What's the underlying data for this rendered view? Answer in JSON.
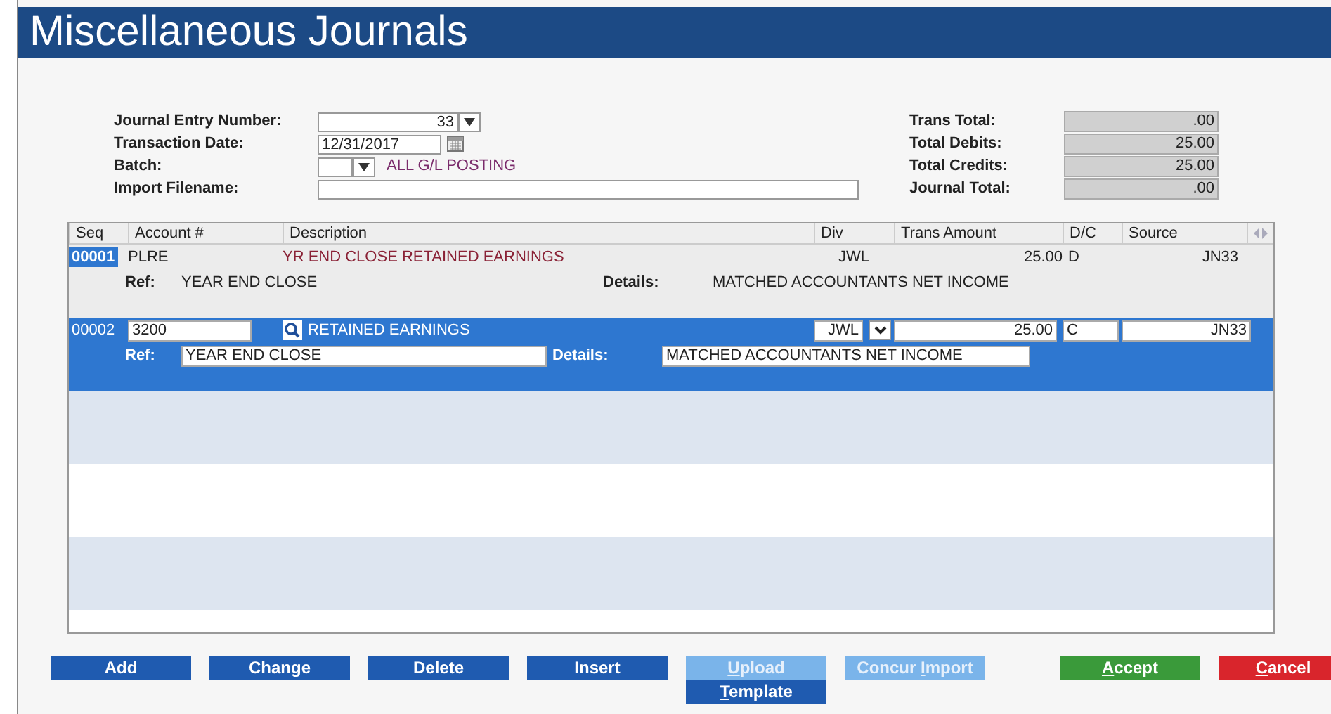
{
  "window": {
    "title": "Miscellaneous Journals"
  },
  "form": {
    "fields": [
      {
        "label": "Journal Entry Number:",
        "kind": "dropdown",
        "value": "33"
      },
      {
        "label": "Transaction Date:",
        "kind": "date",
        "value": "12/31/2017"
      },
      {
        "label": "Batch:",
        "kind": "batch",
        "note": "ALL G/L POSTING"
      },
      {
        "label": "Import Filename:",
        "kind": "text"
      }
    ],
    "totals": [
      {
        "label": "Trans Total:",
        "value": ".00"
      },
      {
        "label": "Total Debits:",
        "value": "25.00"
      },
      {
        "label": "Total Credits:",
        "value": "25.00"
      },
      {
        "label": "Journal Total:",
        "value": ".00"
      }
    ]
  },
  "table": {
    "columns": [
      "Seq",
      "Account #",
      "Description",
      "Div",
      "Trans Amount",
      "D/C",
      "Source"
    ],
    "rows": [
      {
        "selected": false,
        "seq": "00001",
        "account": "PLRE",
        "description": "YR END CLOSE RETAINED EARNINGS",
        "div": "JWL",
        "amount": "25.00",
        "dc": "D",
        "source": "JN33",
        "ref_label": "Ref:",
        "ref": "YEAR END CLOSE",
        "details_label": "Details:",
        "details": "MATCHED ACCOUNTANTS NET INCOME"
      },
      {
        "selected": true,
        "seq": "00002",
        "account": "3200",
        "description": "RETAINED EARNINGS",
        "div": "JWL",
        "amount": "25.00",
        "dc": "C",
        "source": "JN33",
        "ref_label": "Ref:",
        "ref": "YEAR END CLOSE",
        "details_label": "Details:",
        "details": "MATCHED ACCOUNTANTS NET INCOME"
      }
    ]
  },
  "buttons": [
    {
      "kind": "primary",
      "disabled": false,
      "after": "Add"
    },
    {
      "kind": "primary",
      "disabled": false,
      "after": "Change"
    },
    {
      "kind": "primary",
      "disabled": false,
      "after": "Delete"
    },
    {
      "kind": "primary",
      "disabled": false,
      "after": "Insert"
    },
    {
      "kind": "upload",
      "disabled": true,
      "key": "U",
      "after": "pload",
      "sub": {
        "key": "T",
        "after": "emplate",
        "disabled": false
      }
    },
    {
      "kind": "primary",
      "disabled": true,
      "before": "Concur ",
      "key": "I",
      "after": "mport"
    },
    {
      "kind": "accept",
      "disabled": false,
      "key": "A",
      "after": "ccept"
    },
    {
      "kind": "cancel",
      "disabled": false,
      "key": "C",
      "after": "ancel"
    }
  ]
}
